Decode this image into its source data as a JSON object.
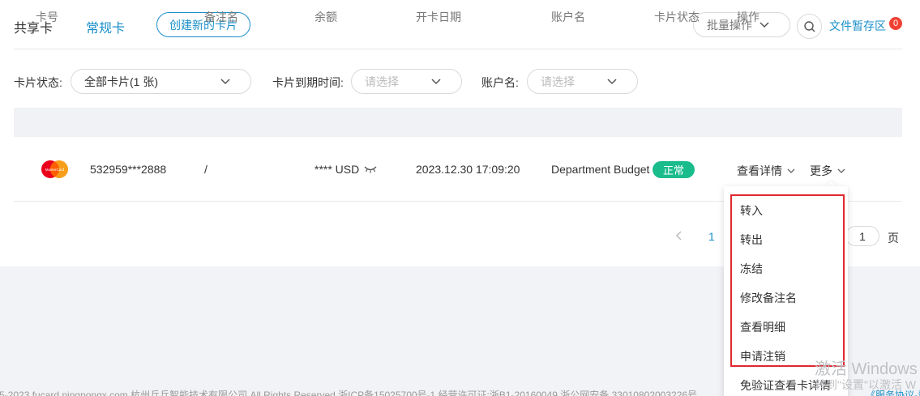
{
  "tabs": {
    "shared": "共享卡",
    "regular": "常规卡"
  },
  "toolbar": {
    "create_label": "创建新的卡片",
    "bulk_label": "批量操作",
    "file_stash_label": "文件暂存区",
    "file_stash_count": "0"
  },
  "filters": {
    "card_status_label": "卡片状态:",
    "card_status_value": "全部卡片(1 张)",
    "expiry_label": "卡片到期时间:",
    "expiry_placeholder": "请选择",
    "account_label": "账户名:",
    "account_placeholder": "请选择"
  },
  "table": {
    "headers": [
      "卡号",
      "备注名",
      "余额",
      "开卡日期",
      "账户名",
      "卡片状态",
      "操作"
    ],
    "rows": [
      {
        "card_brand_text": "MasterCard",
        "card_number": "532959***2888",
        "remark": "/",
        "balance": "**** USD",
        "open_date": "2023.12.30 17:09:20",
        "account": "Department Budget",
        "status": "正常",
        "view_details": "查看详情",
        "more": "更多"
      }
    ]
  },
  "pagination": {
    "current_page": "1",
    "page_input": "1",
    "page_unit": "页"
  },
  "menu": {
    "items": [
      "转入",
      "转出",
      "冻结",
      "修改备注名",
      "查看明细",
      "申请注销",
      "免验证查看卡详情"
    ]
  },
  "footer": {
    "copyright": "5-2023 fucard.pingpongx.com  杭州乒乓智能技术有限公司 All Rights Reserved  浙ICP备15025700号-1  经营许可证:浙B1-20160049  浙公网安备 33010802003226号",
    "service_link": "《服务协议-青"
  },
  "watermark": {
    "line1": "激活 Windows",
    "line2": "转到\"设置\"以激活 W"
  },
  "colors": {
    "accent": "#1a8fc9",
    "status_green": "#1bbc8c",
    "badge_red": "#f04134",
    "highlight_red": "#e0282e"
  },
  "icons": [
    "chevron-down-icon",
    "search-icon",
    "eye-closed-icon",
    "mastercard-logo",
    "chevron-left-icon"
  ]
}
